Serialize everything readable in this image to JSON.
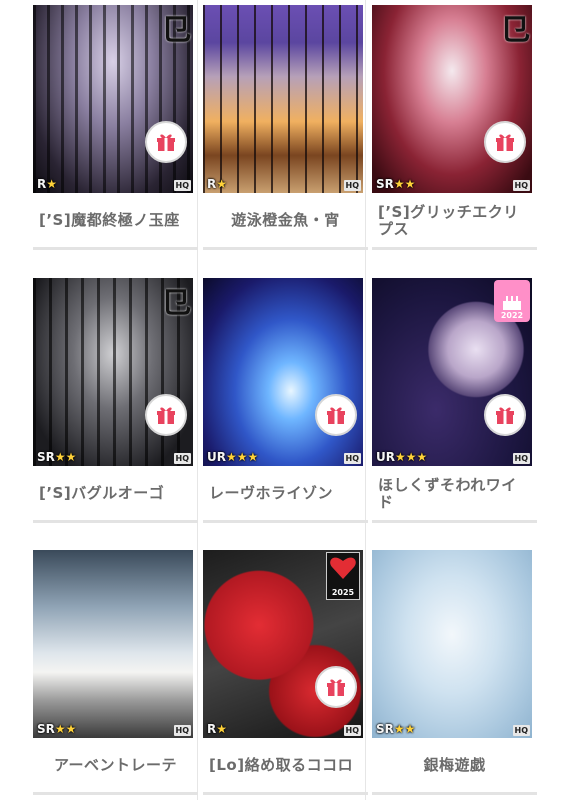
{
  "items": [
    {
      "label": "[’S]魔都終極ノ玉座",
      "rarity": "R",
      "stars": "★",
      "hq": "HQ",
      "gift": true
    },
    {
      "label": "遊泳橙金魚・宵",
      "rarity": "R",
      "stars": "★",
      "hq": "HQ",
      "gift": false
    },
    {
      "label": "[’S]グリッチエクリプス",
      "rarity": "SR",
      "stars": "★★",
      "hq": "HQ",
      "gift": true
    },
    {
      "label": "[’S]バグルオーゴ",
      "rarity": "SR",
      "stars": "★★",
      "hq": "HQ",
      "gift": true
    },
    {
      "label": "レーヴホライゾン",
      "rarity": "UR",
      "stars": "★★★",
      "hq": "HQ",
      "gift": true
    },
    {
      "label": "ほしくずそわれワイド",
      "rarity": "UR",
      "stars": "★★★",
      "hq": "HQ",
      "gift": true,
      "badge_year": "2022"
    },
    {
      "label": "アーベントレーテ",
      "rarity": "SR",
      "stars": "★★",
      "hq": "HQ",
      "gift": false
    },
    {
      "label": "[Lo]絡め取るココロ",
      "rarity": "R",
      "stars": "★",
      "hq": "HQ",
      "gift": true,
      "badge_year": "2025"
    },
    {
      "label": "銀梅遊戯",
      "rarity": "SR",
      "stars": "★★",
      "hq": "HQ",
      "gift": false
    }
  ],
  "colors": {
    "gift": "#e8435e",
    "badge_pink": "#ff8fc8",
    "label_text": "#6b6b6b"
  }
}
